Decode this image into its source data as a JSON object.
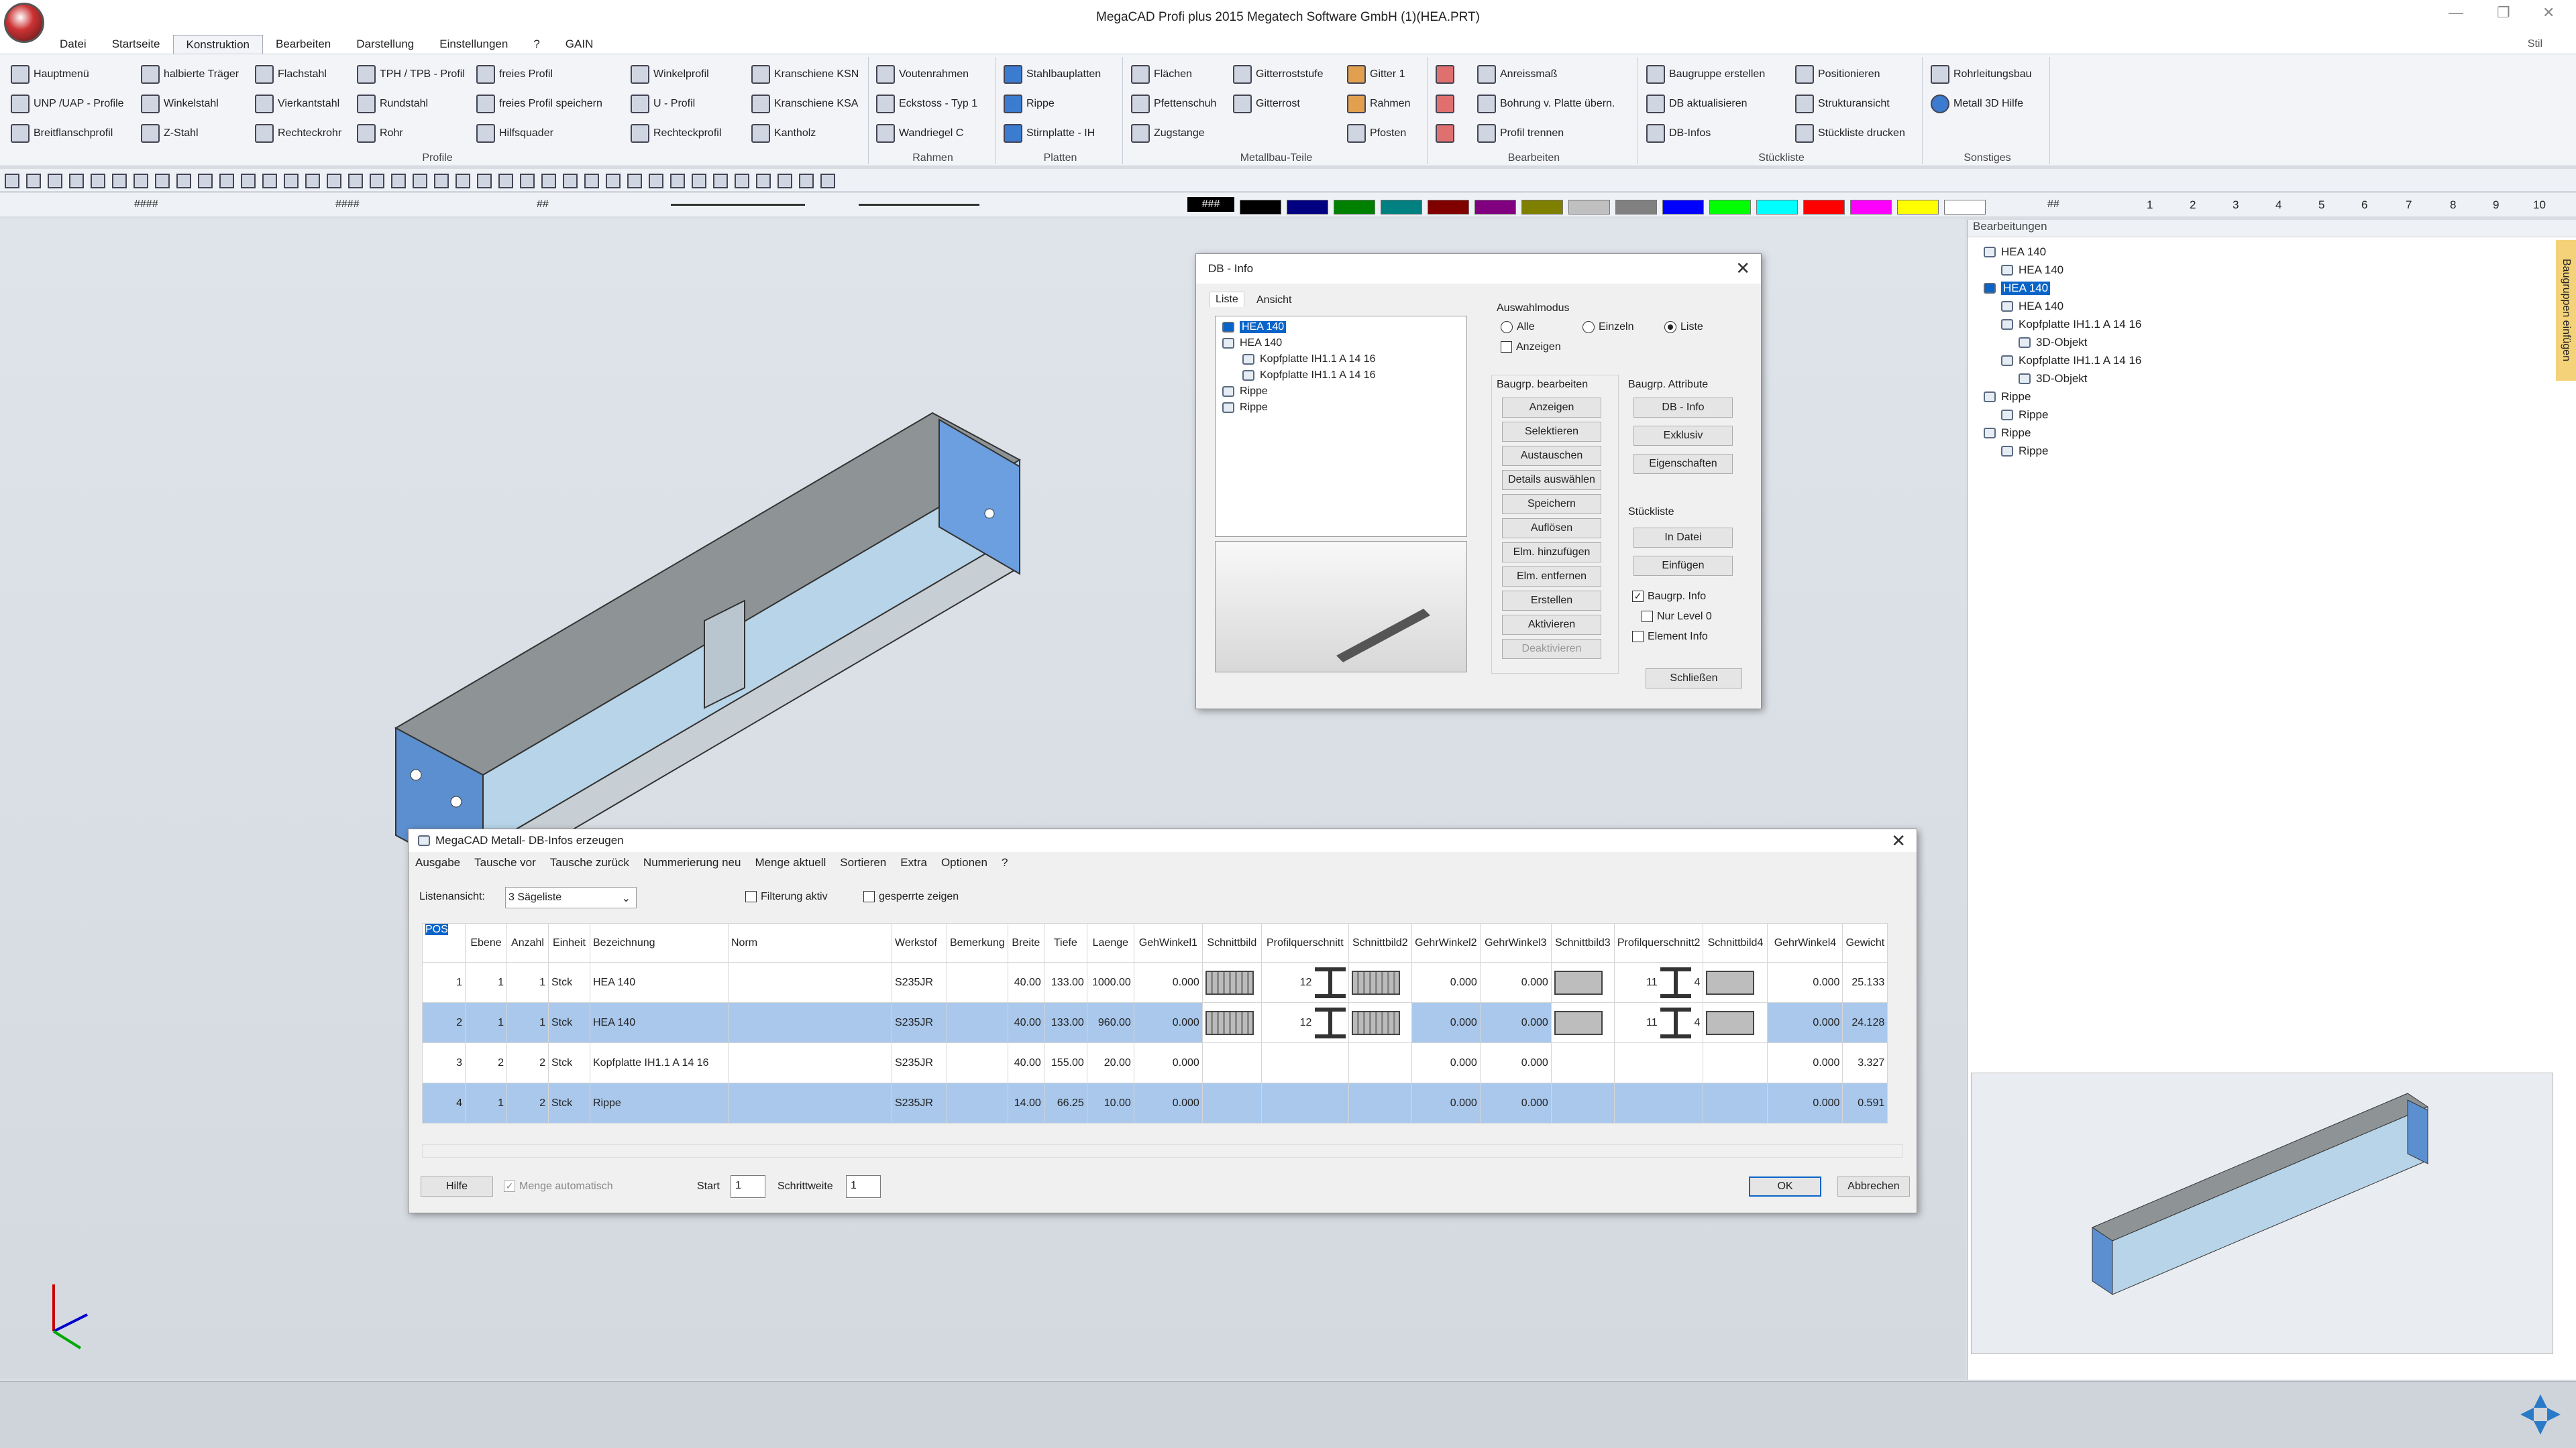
{
  "app": {
    "title": "MegaCAD Profi plus 2015  Megatech Software GmbH (1)(HEA.PRT)",
    "style_label": "Stil"
  },
  "menu": [
    "Datei",
    "Startseite",
    "Konstruktion",
    "Bearbeiten",
    "Darstellung",
    "Einstellungen",
    "?",
    "GAIN"
  ],
  "ribbon": {
    "profile": {
      "label": "Profile",
      "items": [
        "Hauptmenü",
        "halbierte Träger",
        "Flachstahl",
        "TPH / TPB - Profil",
        "freies Profil",
        "UNP /UAP - Profile",
        "Winkelstahl",
        "Vierkantstahl",
        "Rundstahl",
        "freies Profil speichern",
        "Breitflanschprofil",
        "Z-Stahl",
        "Rechteckrohr",
        "Rohr",
        "Hilfsquader",
        "Winkelprofil",
        "U - Profil",
        "Rechteckprofil",
        "Kranschiene KSN",
        "Kranschiene KSA",
        "Kantholz"
      ]
    },
    "rahmen": {
      "label": "Rahmen",
      "items": [
        "Voutenrahmen",
        "Eckstoss - Typ 1",
        "Wandriegel C"
      ]
    },
    "platten": {
      "label": "Platten",
      "items": [
        "Stahlbauplatten",
        "Rippe",
        "Stirnplatte - IH"
      ]
    },
    "metallbau": {
      "label": "Metallbau-Teile",
      "items": [
        "Flächen",
        "Gitterroststufe",
        "Gitter 1",
        "Pfettenschuh",
        "Gitterrost",
        "Rahmen",
        "Zugstange",
        "Pfosten"
      ]
    },
    "bearbeiten": {
      "label": "Bearbeiten",
      "items": [
        "Anreissmaß",
        "Bohrung v. Platte übern.",
        "Profil trennen"
      ]
    },
    "stueckliste": {
      "label": "Stückliste",
      "items": [
        "Baugruppe erstellen",
        "Positionieren",
        "DB aktualisieren",
        "Strukturansicht",
        "DB-Infos",
        "Stückliste drucken"
      ]
    },
    "sonstiges": {
      "label": "Sonstiges",
      "items": [
        "Rohrleitungsbau",
        "Metall 3D Hilfe"
      ]
    }
  },
  "toolbar2": {
    "hash_fields": [
      "####",
      "####",
      "##"
    ],
    "color_label": "###",
    "hash_right": "##",
    "pen_numbers": [
      "1",
      "2",
      "3",
      "4",
      "5",
      "6",
      "7",
      "8",
      "9",
      "10"
    ],
    "colors": [
      "#000000",
      "#000000",
      "#000080",
      "#008000",
      "#008080",
      "#800000",
      "#800080",
      "#808000",
      "#c0c0c0",
      "#808080",
      "#0000ff",
      "#00ff00",
      "#00ffff",
      "#ff0000",
      "#ff00ff",
      "#ffff00",
      "#ffffff"
    ]
  },
  "panel": {
    "title": "Bearbeitungen",
    "side_tab": "Baugruppen einfügen",
    "tree": [
      {
        "label": "HEA 140",
        "level": 0,
        "selected": false
      },
      {
        "label": "HEA 140",
        "level": 1,
        "selected": false
      },
      {
        "label": "HEA 140",
        "level": 0,
        "selected": true
      },
      {
        "label": "HEA 140",
        "level": 1,
        "selected": false
      },
      {
        "label": "Kopfplatte IH1.1 A  14 16",
        "level": 1,
        "selected": false
      },
      {
        "label": "3D-Objekt",
        "level": 2,
        "selected": false
      },
      {
        "label": "Kopfplatte IH1.1 A  14 16",
        "level": 1,
        "selected": false
      },
      {
        "label": "3D-Objekt",
        "level": 2,
        "selected": false
      },
      {
        "label": "Rippe",
        "level": 0,
        "selected": false
      },
      {
        "label": "Rippe",
        "level": 1,
        "selected": false
      },
      {
        "label": "Rippe",
        "level": 0,
        "selected": false
      },
      {
        "label": "Rippe",
        "level": 1,
        "selected": false
      }
    ]
  },
  "dbinfo": {
    "title": "DB - Info",
    "tabs": [
      "Liste",
      "Ansicht"
    ],
    "tree": [
      "HEA 140",
      "HEA 140",
      "Kopfplatte IH1.1 A  14 16",
      "Kopfplatte IH1.1 A  14 16",
      "Rippe",
      "Rippe"
    ],
    "auswahl": {
      "label": "Auswahlmodus",
      "alle": "Alle",
      "einzeln": "Einzeln",
      "liste": "Liste",
      "anzeigen": "Anzeigen"
    },
    "bearbeiten_label": "Baugrp. bearbeiten",
    "bearbeiten_buttons": [
      "Anzeigen",
      "Selektieren",
      "Austauschen",
      "Details auswählen",
      "Speichern",
      "Auflösen",
      "Elm. hinzufügen",
      "Elm. entfernen",
      "Erstellen",
      "Aktivieren",
      "Deaktivieren"
    ],
    "attribute_label": "Baugrp. Attribute",
    "attribute_buttons": [
      "DB - Info",
      "Exklusiv",
      "Eigenschaften"
    ],
    "stueckliste_label": "Stückliste",
    "stueckliste_buttons": [
      "In Datei",
      "Einfügen"
    ],
    "checks": [
      "Baugrp. Info",
      "Nur Level 0",
      "Element Info"
    ],
    "close": "Schließen"
  },
  "meta": {
    "title": "MegaCAD Metall- DB-Infos erzeugen",
    "menu": [
      "Ausgabe",
      "Tausche vor",
      "Tausche zurück",
      "Nummerierung neu",
      "Menge aktuell",
      "Sortieren",
      "Extra",
      "Optionen",
      "?"
    ],
    "listenansicht_label": "Listenansicht:",
    "listenansicht_value": "3 Sägeliste",
    "filterung": "Filterung aktiv",
    "gesperrte": "gesperrte zeigen",
    "columns": [
      "POS",
      "Ebene",
      "Anzahl",
      "Einheit",
      "Bezeichnung",
      "Norm",
      "Werkstof",
      "Bemerkung",
      "Breite",
      "Tiefe",
      "Laenge",
      "GehWinkel1",
      "Schnittbild",
      "Profilquerschnitt",
      "Schnittbild2",
      "GehrWinkel2",
      "GehrWinkel3",
      "Schnittbild3",
      "Profilquerschnitt2",
      "Schnittbild4",
      "GehrWinkel4",
      "Gewicht"
    ],
    "rows": [
      {
        "pos": "1",
        "ebene": "1",
        "anzahl": "1",
        "einheit": "Stck",
        "bez": "HEA 140",
        "norm": "",
        "werk": "S235JR",
        "bem": "",
        "breite": "40.00",
        "tiefe": "133.00",
        "laenge": "1000.00",
        "gw1": "0.000",
        "pq": "12",
        "gw2": "0.000",
        "gw3": "0.000",
        "pq2": "11",
        "pq2b": "4",
        "gw4": "0.000",
        "gewicht": "25.133",
        "hl": false,
        "img": true
      },
      {
        "pos": "2",
        "ebene": "1",
        "anzahl": "1",
        "einheit": "Stck",
        "bez": "HEA 140",
        "norm": "",
        "werk": "S235JR",
        "bem": "",
        "breite": "40.00",
        "tiefe": "133.00",
        "laenge": "960.00",
        "gw1": "0.000",
        "pq": "12",
        "gw2": "0.000",
        "gw3": "0.000",
        "pq2": "11",
        "pq2b": "4",
        "gw4": "0.000",
        "gewicht": "24.128",
        "hl": true,
        "img": true
      },
      {
        "pos": "3",
        "ebene": "2",
        "anzahl": "2",
        "einheit": "Stck",
        "bez": "Kopfplatte IH1.1 A  14 16",
        "norm": "",
        "werk": "S235JR",
        "bem": "",
        "breite": "40.00",
        "tiefe": "155.00",
        "laenge": "20.00",
        "gw1": "0.000",
        "pq": "",
        "gw2": "0.000",
        "gw3": "0.000",
        "pq2": "",
        "pq2b": "",
        "gw4": "0.000",
        "gewicht": "3.327",
        "hl": false,
        "img": false
      },
      {
        "pos": "4",
        "ebene": "1",
        "anzahl": "2",
        "einheit": "Stck",
        "bez": "Rippe",
        "norm": "",
        "werk": "S235JR",
        "bem": "",
        "breite": "14.00",
        "tiefe": "66.25",
        "laenge": "10.00",
        "gw1": "0.000",
        "pq": "",
        "gw2": "0.000",
        "gw3": "0.000",
        "pq2": "",
        "pq2b": "",
        "gw4": "0.000",
        "gewicht": "0.591",
        "hl": true,
        "img": false
      }
    ],
    "hilfe": "Hilfe",
    "menge_auto": "Menge automatisch",
    "start_label": "Start",
    "start_value": "1",
    "schrittweite_label": "Schrittweite",
    "schrittweite_value": "1",
    "ok": "OK",
    "abbrechen": "Abbrechen"
  }
}
